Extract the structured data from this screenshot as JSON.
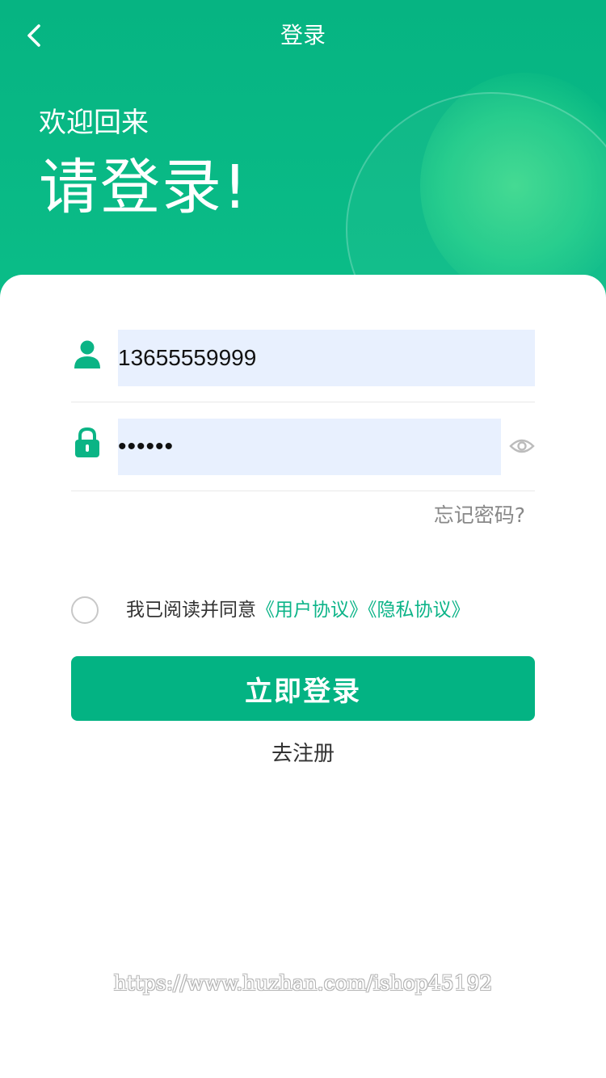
{
  "header": {
    "title": "登录",
    "back_icon": "chevron-left-icon"
  },
  "hero": {
    "welcome": "欢迎回来",
    "headline": "请登录!"
  },
  "form": {
    "phone": {
      "icon": "user-icon",
      "value": "13655559999"
    },
    "password": {
      "icon": "lock-icon",
      "value": "123456",
      "toggle_icon": "eye-icon"
    },
    "forgot_label": "忘记密码?"
  },
  "agreement": {
    "prefix": "我已阅读并同意",
    "user_agreement": "《用户协议》",
    "privacy_policy": "《隐私协议》",
    "checked": false
  },
  "actions": {
    "login_label": "立即登录",
    "register_label": "去注册"
  },
  "watermark": "https://www.huzhan.com/ishop45192",
  "colors": {
    "brand": "#03b383",
    "input_bg": "#e8f0fe",
    "link": "#0db488",
    "muted": "#888888"
  }
}
